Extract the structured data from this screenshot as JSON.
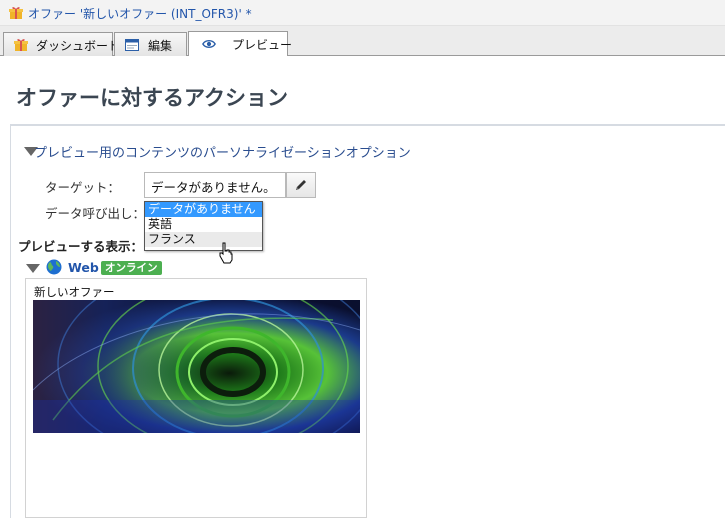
{
  "window": {
    "title": "オファー '新しいオファー (INT_OFR3)' *"
  },
  "tabs": [
    {
      "label": "ダッシュボード",
      "icon": "gift-icon"
    },
    {
      "label": "編集",
      "icon": "form-icon"
    },
    {
      "label": "プレビュー",
      "icon": "eye-icon"
    }
  ],
  "page": {
    "title": "オファーに対するアクション"
  },
  "section": {
    "header": "プレビュー用のコンテンツのパーソナライゼーションオプション"
  },
  "target": {
    "label": "ターゲット：",
    "value": "データがありません。"
  },
  "data_call": {
    "label": "データ呼び出し："
  },
  "dropdown": {
    "options": [
      "データがありません",
      "英語",
      "フランス"
    ],
    "selected_index": 0,
    "hover_index": 2
  },
  "preview": {
    "label": "プレビューする表示：",
    "channel": "Web",
    "status": "オンライン",
    "card_title": "新しいオファー"
  },
  "colors": {
    "accent": "#2255aa",
    "online": "#4caf50",
    "selection": "#3399ff"
  }
}
